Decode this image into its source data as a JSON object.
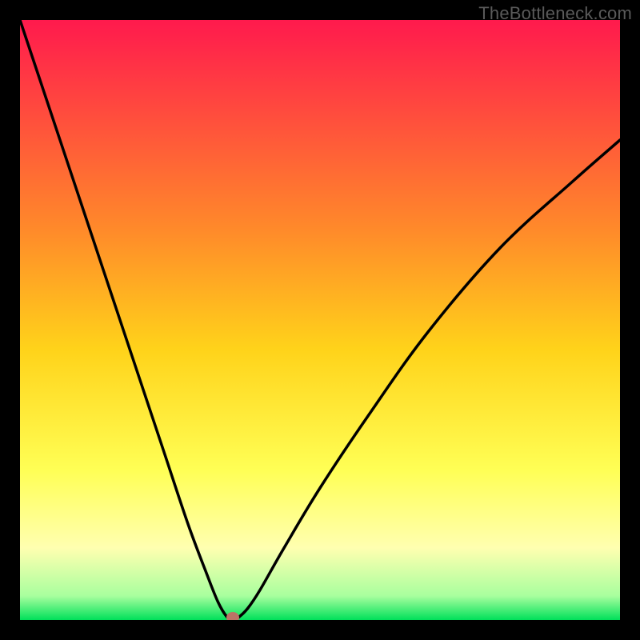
{
  "watermark": "TheBottleneck.com",
  "chart_data": {
    "type": "line",
    "title": "",
    "xlabel": "",
    "ylabel": "",
    "xlim": [
      0,
      100
    ],
    "ylim": [
      0,
      100
    ],
    "grid": false,
    "gradient_stops": [
      {
        "offset": 0,
        "color": "#ff1a4d"
      },
      {
        "offset": 35,
        "color": "#ff8a2a"
      },
      {
        "offset": 55,
        "color": "#ffd31a"
      },
      {
        "offset": 75,
        "color": "#ffff55"
      },
      {
        "offset": 88,
        "color": "#ffffb0"
      },
      {
        "offset": 96,
        "color": "#a8ff9e"
      },
      {
        "offset": 100,
        "color": "#00e05a"
      }
    ],
    "series": [
      {
        "name": "bottleneck-curve",
        "x": [
          0,
          4,
          8,
          12,
          16,
          20,
          24,
          28,
          31,
          33,
          34.5,
          35.5,
          36.5,
          38,
          40,
          44,
          50,
          58,
          68,
          80,
          92,
          100
        ],
        "y": [
          100,
          88,
          76,
          64,
          52,
          40,
          28,
          16,
          8,
          3,
          0.5,
          0,
          0.5,
          2,
          5,
          12,
          22,
          34,
          48,
          62,
          73,
          80
        ]
      }
    ],
    "annotations": [
      {
        "name": "min-marker",
        "x": 35.5,
        "y": 0,
        "color": "#bb7266"
      }
    ]
  }
}
